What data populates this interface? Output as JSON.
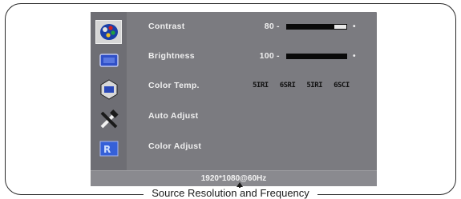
{
  "osd": {
    "menu_icons": [
      "picture-icon",
      "screen-icon",
      "osd-settings-icon",
      "tools-icon",
      "reset-icon"
    ],
    "rows": [
      {
        "label": "Contrast",
        "value": "80",
        "level_percent": 80
      },
      {
        "label": "Brightness",
        "value": "100",
        "level_percent": 100
      },
      {
        "label": "Color Temp.",
        "options": [
          "5IRI",
          "6SRI",
          "5IRI",
          "6SCI"
        ]
      },
      {
        "label": "Auto Adjust"
      },
      {
        "label": "Color Adjust"
      }
    ],
    "controls": {
      "minus": "-",
      "plus": "•"
    },
    "footer": "1920*1080@60Hz"
  },
  "caption": "Source Resolution and Frequency",
  "colors": {
    "osd_bg": "#7b7b80",
    "sidebar_bg": "#6e6e74",
    "bar": "#0a0a0a"
  }
}
